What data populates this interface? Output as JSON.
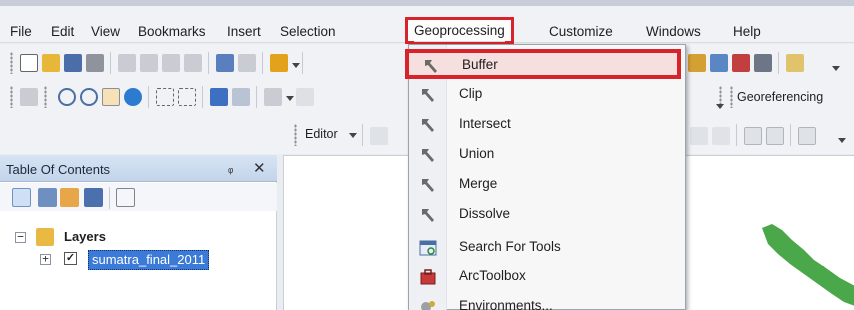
{
  "menubar": {
    "items": [
      "File",
      "Edit",
      "View",
      "Bookmarks",
      "Insert",
      "Selection",
      "Geoprocessing",
      "Customize",
      "Windows",
      "Help"
    ],
    "active_item": "Geoprocessing"
  },
  "toolbars": {
    "editor_label": "Editor",
    "georeferencing_label": "Georeferencing"
  },
  "toc": {
    "title": "Table Of Contents",
    "pin_glyph": "ᵩ",
    "close_glyph": "✕",
    "group_label": "Layers",
    "layer_name": "sumatra_final_2011",
    "layer_checked": true
  },
  "geoprocessing_menu": {
    "items": [
      {
        "label": "Buffer",
        "icon": "hammer-icon",
        "selected": true
      },
      {
        "label": "Clip",
        "icon": "hammer-icon"
      },
      {
        "label": "Intersect",
        "icon": "hammer-icon"
      },
      {
        "label": "Union",
        "icon": "hammer-icon"
      },
      {
        "label": "Merge",
        "icon": "hammer-icon"
      },
      {
        "label": "Dissolve",
        "icon": "hammer-icon"
      },
      {
        "label": "Search For Tools",
        "icon": "search-window-icon"
      },
      {
        "label": "ArcToolbox",
        "icon": "toolbox-icon"
      },
      {
        "label": "Environments...",
        "icon": "gears-icon"
      }
    ]
  },
  "colors": {
    "highlight_border": "#d8232a",
    "selected_layer": "#3b7ad7",
    "map_feature": "#4aa84a"
  }
}
